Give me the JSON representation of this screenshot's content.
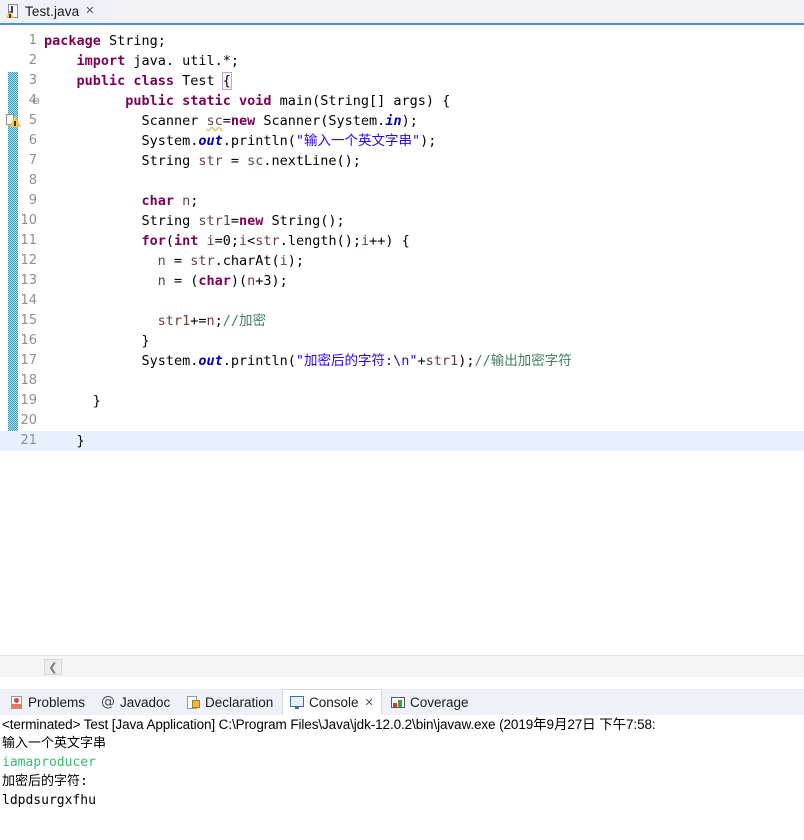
{
  "editor": {
    "tab": {
      "title": "Test.java",
      "close_label": "✕",
      "icon": "java-file-warning-icon"
    },
    "gutter": {
      "fold_marker": "⊖",
      "warning_annotation": "warning-marker-icon",
      "change_bar_color": "#3aa6c4"
    },
    "hscroll": {
      "left_arrow": "❮"
    },
    "lines": [
      {
        "num": "1",
        "fold": "",
        "indent": 0,
        "segments": [
          {
            "t": "package ",
            "c": "kw"
          },
          {
            "t": "String;",
            "c": ""
          }
        ]
      },
      {
        "num": "2",
        "fold": "",
        "indent": 4,
        "segments": [
          {
            "t": "import ",
            "c": "kw"
          },
          {
            "t": "java. util.*;",
            "c": ""
          }
        ]
      },
      {
        "num": "3",
        "fold": "",
        "indent": 4,
        "segments": [
          {
            "t": "public class ",
            "c": "kw"
          },
          {
            "t": "Test ",
            "c": ""
          },
          {
            "t": "{",
            "c": "bracket-hl"
          }
        ]
      },
      {
        "num": "4",
        "fold": "⊖",
        "indent": 10,
        "segments": [
          {
            "t": "public static void ",
            "c": "kw"
          },
          {
            "t": "main(String[] args) {",
            "c": ""
          }
        ]
      },
      {
        "num": "5",
        "fold": "",
        "indent": 12,
        "segments": [
          {
            "t": "Scanner ",
            "c": ""
          },
          {
            "t": "sc",
            "c": "loc und"
          },
          {
            "t": "=",
            "c": ""
          },
          {
            "t": "new ",
            "c": "kw"
          },
          {
            "t": "Scanner(System.",
            "c": ""
          },
          {
            "t": "in",
            "c": "fld"
          },
          {
            "t": ");",
            "c": ""
          }
        ]
      },
      {
        "num": "6",
        "fold": "",
        "indent": 12,
        "segments": [
          {
            "t": "System.",
            "c": ""
          },
          {
            "t": "out",
            "c": "fld"
          },
          {
            "t": ".println(",
            "c": ""
          },
          {
            "t": "\"输入一个英文字串\"",
            "c": "str"
          },
          {
            "t": ");",
            "c": ""
          }
        ]
      },
      {
        "num": "7",
        "fold": "",
        "indent": 12,
        "segments": [
          {
            "t": "String ",
            "c": ""
          },
          {
            "t": "str",
            "c": "loc"
          },
          {
            "t": " = ",
            "c": ""
          },
          {
            "t": "sc",
            "c": "loc"
          },
          {
            "t": ".nextLine();",
            "c": ""
          }
        ]
      },
      {
        "num": "8",
        "fold": "",
        "indent": 12,
        "segments": []
      },
      {
        "num": "9",
        "fold": "",
        "indent": 12,
        "segments": [
          {
            "t": "char ",
            "c": "kw"
          },
          {
            "t": "n",
            "c": "loc"
          },
          {
            "t": ";",
            "c": ""
          }
        ]
      },
      {
        "num": "10",
        "fold": "",
        "indent": 12,
        "segments": [
          {
            "t": "String ",
            "c": ""
          },
          {
            "t": "str1",
            "c": "loc"
          },
          {
            "t": "=",
            "c": ""
          },
          {
            "t": "new ",
            "c": "kw"
          },
          {
            "t": "String();",
            "c": ""
          }
        ]
      },
      {
        "num": "11",
        "fold": "",
        "indent": 12,
        "segments": [
          {
            "t": "for",
            "c": "kw"
          },
          {
            "t": "(",
            "c": ""
          },
          {
            "t": "int ",
            "c": "kw"
          },
          {
            "t": "i",
            "c": "loc"
          },
          {
            "t": "=0;",
            "c": ""
          },
          {
            "t": "i",
            "c": "loc"
          },
          {
            "t": "<",
            "c": ""
          },
          {
            "t": "str",
            "c": "loc"
          },
          {
            "t": ".length();",
            "c": ""
          },
          {
            "t": "i",
            "c": "loc"
          },
          {
            "t": "++) {",
            "c": ""
          }
        ]
      },
      {
        "num": "12",
        "fold": "",
        "indent": 14,
        "segments": [
          {
            "t": "n",
            "c": "loc"
          },
          {
            "t": " = ",
            "c": ""
          },
          {
            "t": "str",
            "c": "loc"
          },
          {
            "t": ".charAt(",
            "c": ""
          },
          {
            "t": "i",
            "c": "loc"
          },
          {
            "t": ");",
            "c": ""
          }
        ]
      },
      {
        "num": "13",
        "fold": "",
        "indent": 14,
        "segments": [
          {
            "t": "n",
            "c": "loc"
          },
          {
            "t": " = (",
            "c": ""
          },
          {
            "t": "char",
            "c": "kw"
          },
          {
            "t": ")(",
            "c": ""
          },
          {
            "t": "n",
            "c": "loc"
          },
          {
            "t": "+3);",
            "c": ""
          }
        ]
      },
      {
        "num": "14",
        "fold": "",
        "indent": 14,
        "segments": []
      },
      {
        "num": "15",
        "fold": "",
        "indent": 14,
        "segments": [
          {
            "t": "str1",
            "c": "loc"
          },
          {
            "t": "+=",
            "c": ""
          },
          {
            "t": "n",
            "c": "loc"
          },
          {
            "t": ";",
            "c": ""
          },
          {
            "t": "//加密",
            "c": "cmt"
          }
        ]
      },
      {
        "num": "16",
        "fold": "",
        "indent": 12,
        "segments": [
          {
            "t": "}",
            "c": ""
          }
        ]
      },
      {
        "num": "17",
        "fold": "",
        "indent": 12,
        "segments": [
          {
            "t": "System.",
            "c": ""
          },
          {
            "t": "out",
            "c": "fld"
          },
          {
            "t": ".println(",
            "c": ""
          },
          {
            "t": "\"加密后的字符:\\n\"",
            "c": "str"
          },
          {
            "t": "+",
            "c": ""
          },
          {
            "t": "str1",
            "c": "loc"
          },
          {
            "t": ");",
            "c": ""
          },
          {
            "t": "//输出加密字符",
            "c": "cmt"
          }
        ]
      },
      {
        "num": "18",
        "fold": "",
        "indent": 12,
        "segments": []
      },
      {
        "num": "19",
        "fold": "",
        "indent": 6,
        "segments": [
          {
            "t": "}",
            "c": ""
          }
        ]
      },
      {
        "num": "20",
        "fold": "",
        "indent": 6,
        "segments": []
      },
      {
        "num": "21",
        "fold": "",
        "indent": 4,
        "segments": [
          {
            "t": "}",
            "c": ""
          }
        ],
        "current": true
      }
    ]
  },
  "bottom_panel": {
    "tabs": [
      {
        "label": "Problems",
        "icon": "problems-icon",
        "active": false,
        "close": ""
      },
      {
        "label": "Javadoc",
        "icon": "javadoc-icon",
        "active": false,
        "close": ""
      },
      {
        "label": "Declaration",
        "icon": "declaration-icon",
        "active": false,
        "close": ""
      },
      {
        "label": "Console",
        "icon": "console-icon",
        "active": true,
        "close": "✕"
      },
      {
        "label": "Coverage",
        "icon": "coverage-icon",
        "active": false,
        "close": ""
      }
    ],
    "console": {
      "lines": [
        {
          "text": "<terminated> Test [Java Application] C:\\Program Files\\Java\\jdk-12.0.2\\bin\\javaw.exe (2019年9月27日 下午7:58:",
          "kind": "header"
        },
        {
          "text": "输入一个英文字串",
          "kind": "output"
        },
        {
          "text": "iamaproducer",
          "kind": "input"
        },
        {
          "text": "加密后的字符:",
          "kind": "output"
        },
        {
          "text": "ldpdsurgxfhu",
          "kind": "output"
        }
      ],
      "input_color": "#3cb878"
    }
  }
}
